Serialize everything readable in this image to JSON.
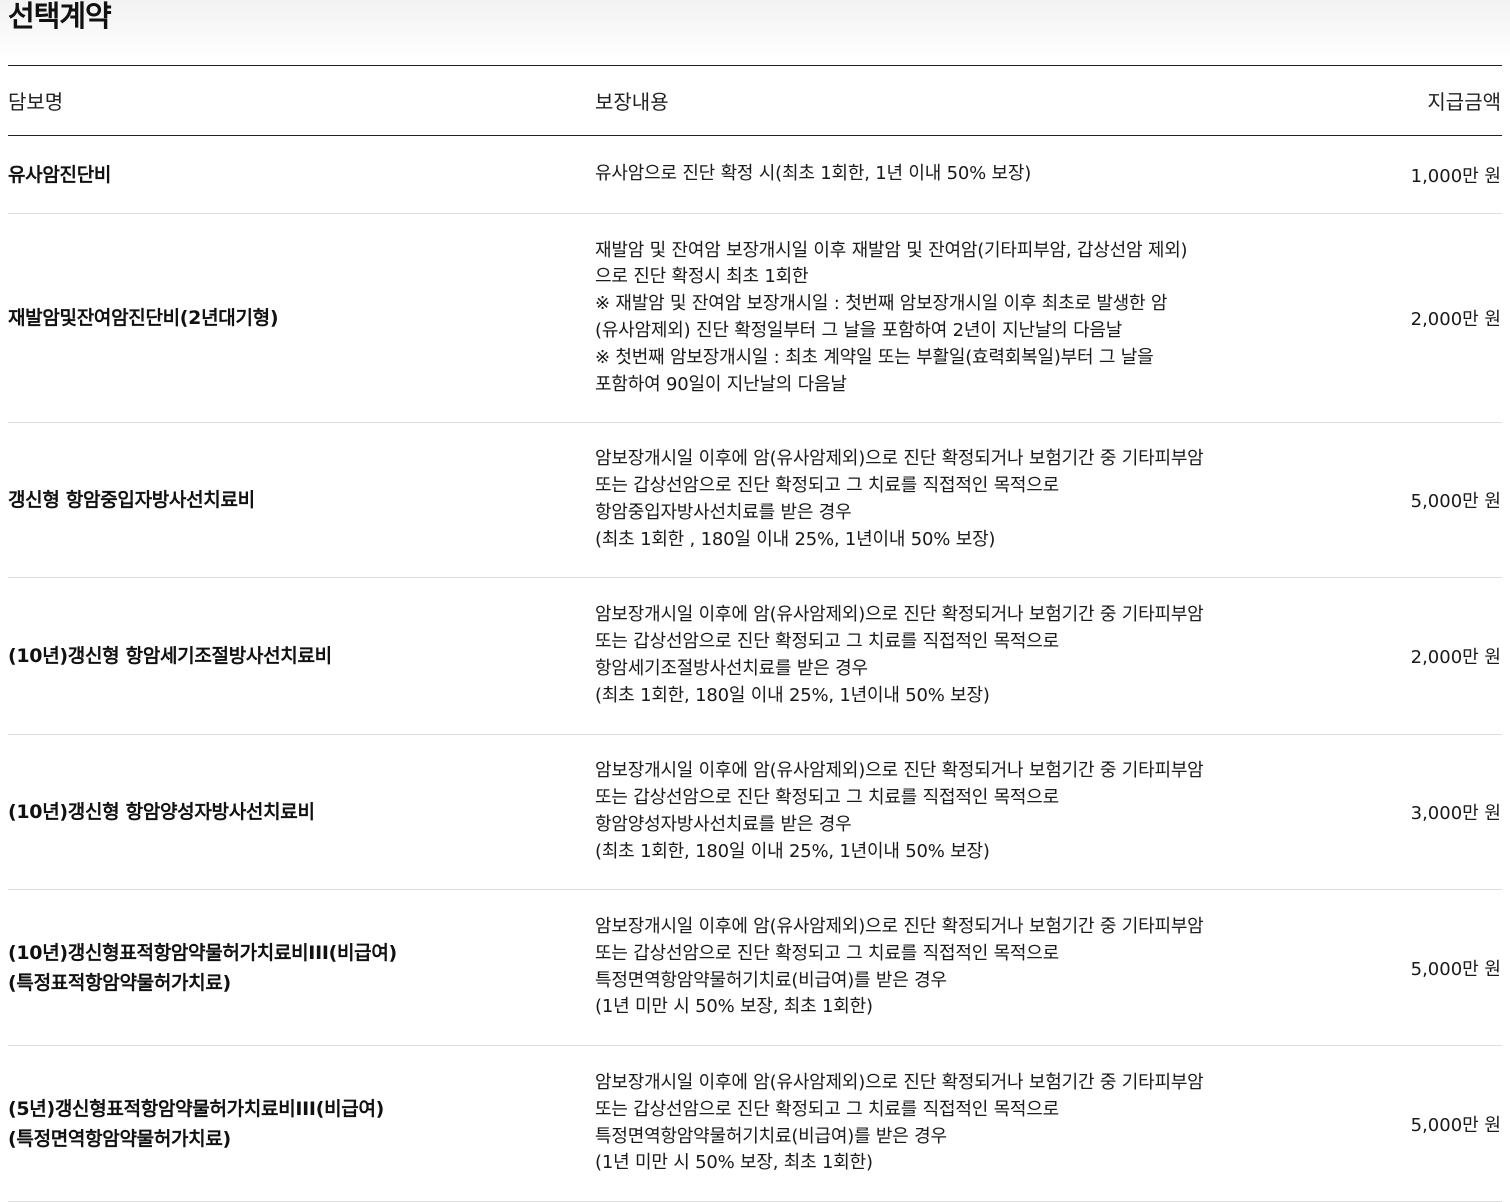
{
  "section": {
    "title": "선택계약"
  },
  "table": {
    "headers": {
      "name": "담보명",
      "desc": "보장내용",
      "amount": "지급금액"
    },
    "rows": [
      {
        "name": [
          "유사암진단비"
        ],
        "desc": [
          "유사암으로 진단 확정 시(최초 1회한, 1년 이내 50% 보장)"
        ],
        "amount": "1,000만 원"
      },
      {
        "name": [
          "재발암및잔여암진단비(2년대기형)"
        ],
        "desc": [
          "재발암 및 잔여암 보장개시일 이후 재발암 및 잔여암(기타피부암, 갑상선암 제외)",
          "으로 진단 확정시 최초 1회한",
          "※ 재발암 및 잔여암 보장개시일 : 첫번째 암보장개시일 이후 최초로 발생한 암",
          "(유사암제외) 진단 확정일부터 그 날을 포함하여 2년이 지난날의 다음날",
          "※ 첫번째 암보장개시일 : 최초 계약일 또는 부활일(효력회복일)부터 그 날을",
          "포함하여 90일이 지난날의 다음날"
        ],
        "amount": "2,000만 원"
      },
      {
        "name": [
          "갱신형 항암중입자방사선치료비"
        ],
        "desc": [
          "암보장개시일 이후에 암(유사암제외)으로 진단 확정되거나 보험기간 중 기타피부암",
          "또는 갑상선암으로 진단 확정되고 그 치료를 직접적인 목적으로",
          "항암중입자방사선치료를 받은 경우",
          "(최초 1회한 , 180일 이내 25%, 1년이내 50% 보장)"
        ],
        "amount": "5,000만 원"
      },
      {
        "name": [
          "(10년)갱신형 항암세기조절방사선치료비"
        ],
        "desc": [
          "암보장개시일 이후에 암(유사암제외)으로 진단 확정되거나 보험기간 중 기타피부암",
          "또는 갑상선암으로 진단 확정되고 그 치료를 직접적인 목적으로",
          "항암세기조절방사선치료를 받은 경우",
          "(최초 1회한, 180일 이내 25%, 1년이내 50% 보장)"
        ],
        "amount": "2,000만 원"
      },
      {
        "name": [
          "(10년)갱신형 항암양성자방사선치료비"
        ],
        "desc": [
          "암보장개시일 이후에 암(유사암제외)으로 진단 확정되거나 보험기간 중 기타피부암",
          "또는 갑상선암으로 진단 확정되고 그 치료를 직접적인 목적으로",
          "항암양성자방사선치료를 받은 경우",
          "(최초 1회한, 180일 이내 25%, 1년이내 50% 보장)"
        ],
        "amount": "3,000만 원"
      },
      {
        "name": [
          "(10년)갱신형표적항암약물허가치료비III(비급여)",
          "(특정표적항암약물허가치료)"
        ],
        "desc": [
          "암보장개시일 이후에 암(유사암제외)으로 진단 확정되거나 보험기간 중 기타피부암",
          "또는 갑상선암으로 진단 확정되고 그 치료를 직접적인 목적으로",
          "특정면역항암약물허기치료(비급여)를 받은 경우",
          "(1년 미만 시 50% 보장, 최초 1회한)"
        ],
        "amount": "5,000만 원"
      },
      {
        "name": [
          "(5년)갱신형표적항암약물허가치료비III(비급여)",
          "(특정면역항암약물허가치료)"
        ],
        "desc": [
          "암보장개시일 이후에 암(유사암제외)으로 진단 확정되거나 보험기간 중 기타피부암",
          "또는 갑상선암으로 진단 확정되고 그 치료를 직접적인 목적으로",
          "특정면역항암약물허기치료(비급여)를 받은 경우",
          "(1년 미만 시 50% 보장, 최초 1회한)"
        ],
        "amount": "5,000만 원"
      }
    ]
  }
}
